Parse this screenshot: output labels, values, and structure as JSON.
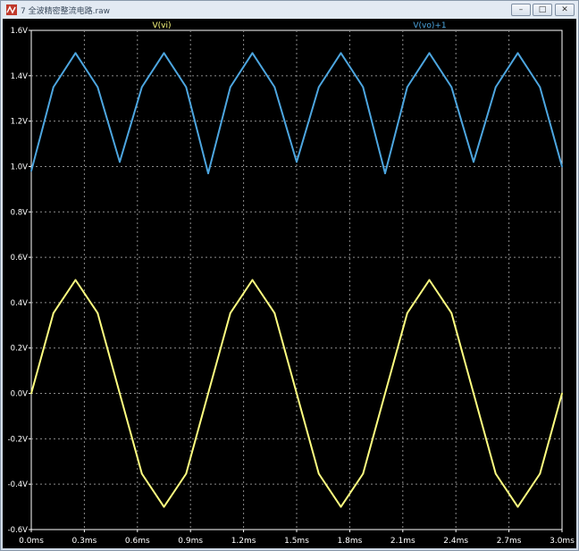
{
  "window": {
    "title": "7 全波精密整流电路.raw",
    "minimize_glyph": "–",
    "maximize_glyph": "□",
    "close_glyph": "✕",
    "icon": "waveform-app-icon"
  },
  "chart_data": {
    "type": "line",
    "title": "",
    "xlabel": "",
    "ylabel": "",
    "xlim": [
      0,
      3.0
    ],
    "ylim": [
      -0.6,
      1.6
    ],
    "x_unit": "ms",
    "y_unit": "V",
    "x_ticks": [
      "0.0ms",
      "0.3ms",
      "0.6ms",
      "0.9ms",
      "1.2ms",
      "1.5ms",
      "1.8ms",
      "2.1ms",
      "2.4ms",
      "2.7ms",
      "3.0ms"
    ],
    "y_ticks": [
      "1.6V",
      "1.4V",
      "1.2V",
      "1.0V",
      "0.8V",
      "0.6V",
      "0.4V",
      "0.2V",
      "0.0V",
      "-0.2V",
      "-0.4V",
      "-0.6V"
    ],
    "grid": true,
    "background": "#000000",
    "grid_color": "#8c8c8c",
    "legend_placement": "top",
    "series": [
      {
        "name": "V(vi)",
        "color": "#ffff80",
        "x": [
          0.0,
          0.125,
          0.25,
          0.375,
          0.5,
          0.625,
          0.75,
          0.875,
          1.0,
          1.125,
          1.25,
          1.375,
          1.5,
          1.625,
          1.75,
          1.875,
          2.0,
          2.125,
          2.25,
          2.375,
          2.5,
          2.625,
          2.75,
          2.875,
          3.0
        ],
        "y": [
          0.0,
          0.354,
          0.5,
          0.354,
          0.0,
          -0.354,
          -0.5,
          -0.354,
          0.0,
          0.354,
          0.5,
          0.354,
          0.0,
          -0.354,
          -0.5,
          -0.354,
          0.0,
          0.354,
          0.5,
          0.354,
          0.0,
          -0.354,
          -0.5,
          -0.354,
          0.0
        ]
      },
      {
        "name": "V(vo)+1",
        "color": "#4da6e0",
        "x": [
          0.0,
          0.125,
          0.25,
          0.375,
          0.5,
          0.625,
          0.75,
          0.875,
          1.0,
          1.125,
          1.25,
          1.375,
          1.5,
          1.625,
          1.75,
          1.875,
          2.0,
          2.125,
          2.25,
          2.375,
          2.5,
          2.625,
          2.75,
          2.875,
          3.0
        ],
        "y": [
          0.98,
          1.35,
          1.5,
          1.35,
          1.02,
          1.35,
          1.5,
          1.35,
          0.97,
          1.35,
          1.5,
          1.35,
          1.02,
          1.35,
          1.5,
          1.35,
          0.97,
          1.35,
          1.5,
          1.35,
          1.02,
          1.35,
          1.5,
          1.35,
          1.0
        ]
      }
    ]
  }
}
